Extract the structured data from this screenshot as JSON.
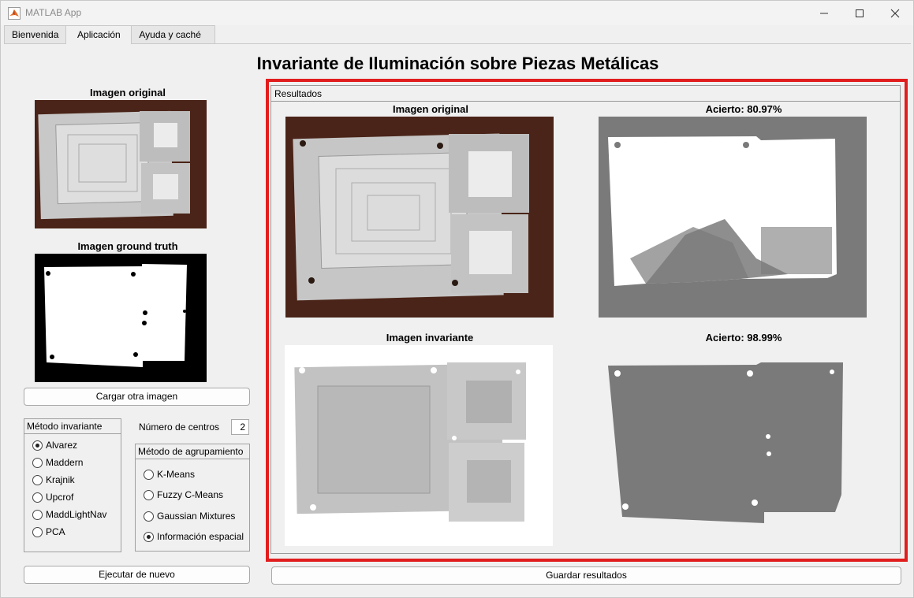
{
  "window": {
    "title": "MATLAB App",
    "min_icon": "minimize-icon",
    "max_icon": "maximize-icon",
    "close_icon": "close-icon"
  },
  "tabs": [
    {
      "label": "Bienvenida"
    },
    {
      "label": "Aplicación",
      "active": true
    },
    {
      "label": "Ayuda y caché"
    }
  ],
  "main_title": "Invariante de Iluminación sobre Piezas Metálicas",
  "left": {
    "original_label": "Imagen original",
    "ground_truth_label": "Imagen ground truth",
    "load_button": "Cargar otra imagen",
    "method_group": {
      "title": "Método invariante",
      "options": [
        "Alvarez",
        "Maddern",
        "Krajnik",
        "Upcrof",
        "MaddLightNav",
        "PCA"
      ],
      "selected": "Alvarez"
    },
    "centers_label": "Número de centros",
    "centers_value": "2",
    "cluster_group": {
      "title": "Método de agrupamiento",
      "options": [
        "K-Means",
        "Fuzzy C-Means",
        "Gaussian Mixtures",
        "Información espacial"
      ],
      "selected": "Información espacial"
    },
    "run_button": "Ejecutar de nuevo"
  },
  "results": {
    "title": "Resultados",
    "original_label": "Imagen original",
    "accuracy1_label": "Acierto: 80.97%",
    "invariant_label": "Imagen invariante",
    "accuracy2_label": "Acierto: 98.99%"
  },
  "save_button": "Guardar resultados",
  "colors": {
    "highlight": "#e11d1d",
    "wood": "#4a2418",
    "metal": "#c9c9c9",
    "mask_gray": "#7a7a7a"
  }
}
